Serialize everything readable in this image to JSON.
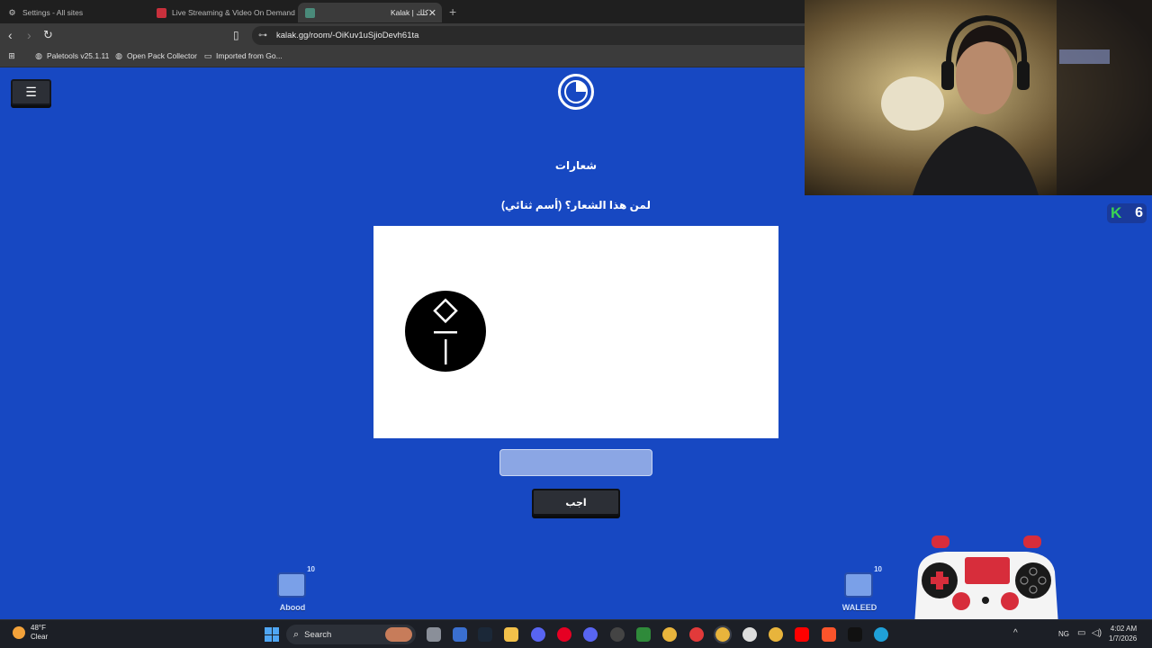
{
  "browser": {
    "tabs": [
      {
        "label": "Settings - All sites",
        "icon": "gear-icon"
      },
      {
        "label": "Live Streaming & Video On Demand",
        "icon": "site-icon"
      },
      {
        "label": "Kalak | كلك",
        "icon": "kalak-icon"
      }
    ],
    "url": "kalak.gg/room/-OiKuv1uSjioDevh61ta",
    "bookmarks": [
      {
        "label": "Paletools v25.1.11",
        "icon": "globe-icon"
      },
      {
        "label": "Open Pack Collector",
        "icon": "globe-icon"
      },
      {
        "label": "Imported from Go...",
        "icon": "folder-icon"
      }
    ]
  },
  "game": {
    "category": "شعارات",
    "question": "لمن هذا الشعار؟ (أسم ثنائي)",
    "answer_value": "",
    "submit_label": "اجب",
    "score_letter": "K",
    "score_value": "6",
    "players": [
      {
        "name": "Abood",
        "score": "10"
      },
      {
        "name": "WALEED",
        "score": "10"
      }
    ]
  },
  "taskbar": {
    "weather_temp": "48°F",
    "weather_desc": "Clear",
    "search_placeholder": "Search",
    "time": "4:02 AM",
    "date": "1/7/2026",
    "lang": "NG"
  },
  "colors": {
    "page_bg": "#1748c2",
    "accent_green": "#39d353"
  }
}
